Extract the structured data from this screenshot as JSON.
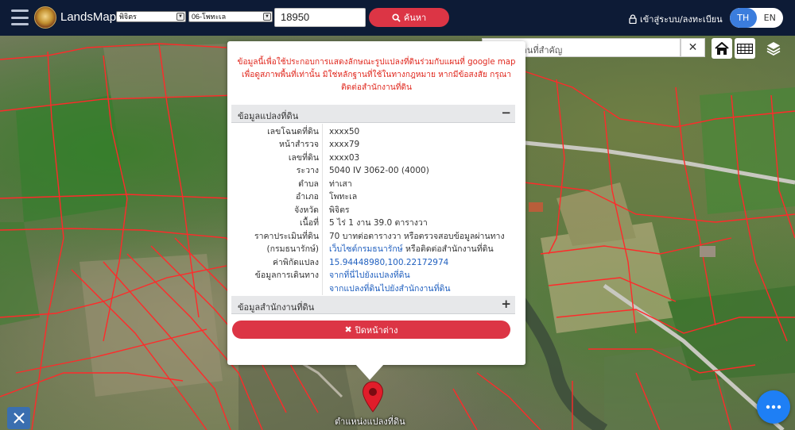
{
  "navbar": {
    "brand": "LandsMaps",
    "province_select": "พิจิตร",
    "district_select": "06-โพทะเล",
    "parcel_number": "18950",
    "search_label": "ค้นหา",
    "login_label": "เข้าสู่ระบบ/ลงทะเบียน",
    "lang_th": "TH",
    "lang_en": "EN"
  },
  "map_tools": {
    "place_search_placeholder": "ค้นหาสถานที่สำคัญ",
    "clear_label": "✕"
  },
  "popup": {
    "disclaimer_line1": "ข้อมูลนี้เพื่อใช้ประกอบการแสดงลักษณะรูปแปลงที่ดินร่วมกับแผนที่ google map",
    "disclaimer_line2": "เพื่อดูสภาพพื้นที่เท่านั้น มิใช่หลักฐานที่ใช้ในทางกฎหมาย หากมีข้อสงสัย กรุณา",
    "disclaimer_line3": "ติดต่อสำนักงานที่ดิน",
    "section_parcel": "ข้อมูลแปลงที่ดิน",
    "section_parcel_toggle": "−",
    "section_office": "ข้อมูลสำนักงานที่ดิน",
    "section_office_toggle": "+",
    "rows": [
      {
        "key": "เลขโฉนดที่ดิน",
        "value": "xxxx50"
      },
      {
        "key": "หน้าสำรวจ",
        "value": "xxxx79"
      },
      {
        "key": "เลขที่ดิน",
        "value": "xxxx03"
      },
      {
        "key": "ระวาง",
        "value": "5040 IV 3062-00 (4000)"
      },
      {
        "key": "ตำบล",
        "value": "ท่าเสา"
      },
      {
        "key": "อำเภอ",
        "value": "โพทะเล"
      },
      {
        "key": "จังหวัด",
        "value": "พิจิตร"
      },
      {
        "key": "เนื้อที่",
        "value": "5 ไร่ 1 งาน 39.0 ตารางวา"
      },
      {
        "key": "ราคาประเมินที่ดิน",
        "value": "70 บาทต่อตารางวา หรือตรวจสอบข้อมูลผ่านทาง"
      },
      {
        "key": "(กรมธนารักษ์)",
        "value_link": "เว็บไซต์กรมธนารักษ์",
        "value_rest": " หรือติดต่อสำนักงานที่ดิน"
      },
      {
        "key": "ค่าพิกัดแปลง",
        "value": "15.94448980,100.22172974"
      },
      {
        "key": "ข้อมูลการเดินทาง",
        "value": "จากที่นี่ไปยังแปลงที่ดิน"
      },
      {
        "key": "",
        "value": "จากแปลงที่ดินไปยังสำนักงานที่ดิน"
      }
    ],
    "close_label": "ปิดหน้าต่าง"
  },
  "map": {
    "pin_label": "ตำแหน่งแปลงที่ดิน"
  },
  "colors": {
    "navbar_bg": "#0d1b36",
    "accent_red": "#dc3545",
    "accent_blue": "#3b7ddd",
    "parcel_line": "#ff2a2a",
    "link_blue": "#1f5fbf"
  }
}
